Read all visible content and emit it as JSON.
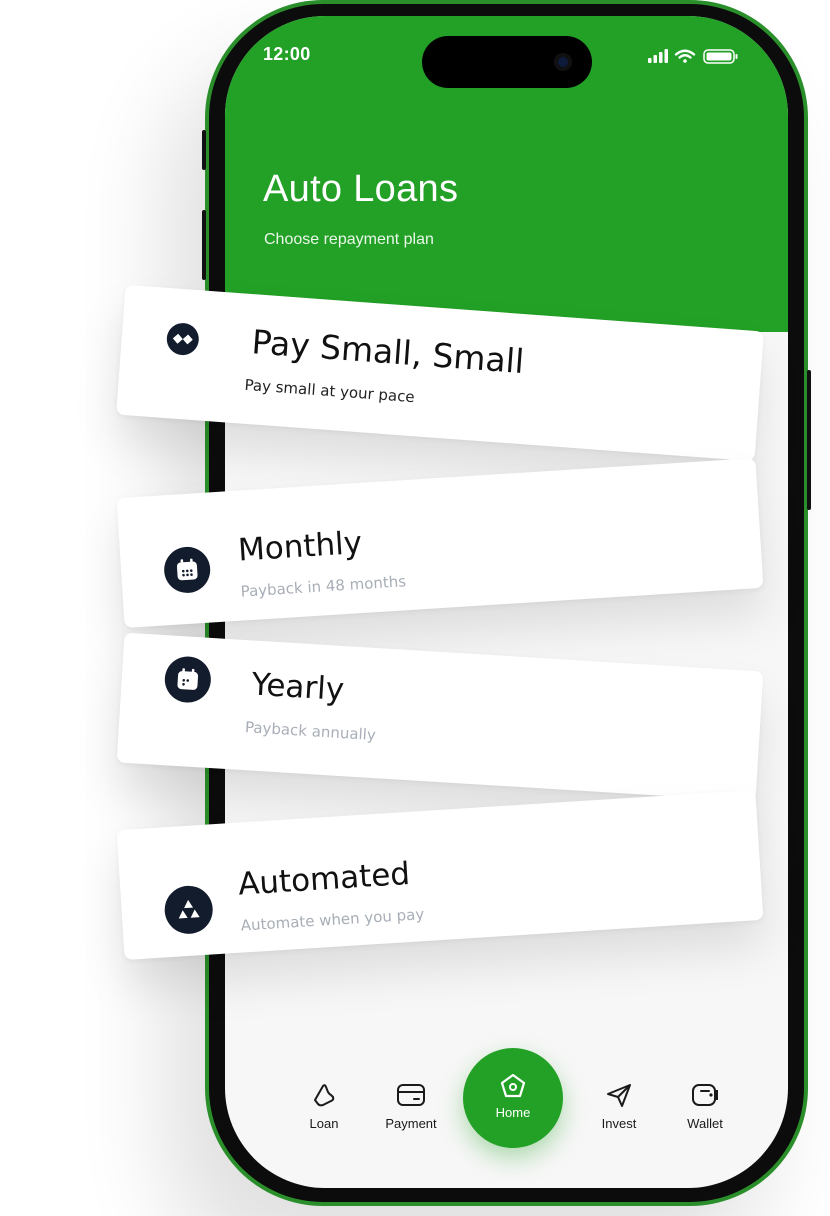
{
  "status_bar": {
    "time": "12:00"
  },
  "header": {
    "title": "Auto Loans",
    "subtitle": "Choose repayment plan",
    "accent_color": "#23a126"
  },
  "plans": [
    {
      "title": "Pay Small, Small",
      "subtitle": "Pay small at your pace",
      "icon": "diamond-dots-icon"
    },
    {
      "title": "Monthly",
      "subtitle": "Payback in 48 months",
      "icon": "calendar-icon"
    },
    {
      "title": "Yearly",
      "subtitle": "Payback annually",
      "icon": "calendar-year-icon"
    },
    {
      "title": "Automated",
      "subtitle": "Automate when you pay",
      "icon": "triangles-icon"
    }
  ],
  "bottom_nav": {
    "items": [
      {
        "label": "Loan",
        "icon": "loan-icon"
      },
      {
        "label": "Payment",
        "icon": "card-icon"
      },
      {
        "label": "Home",
        "icon": "home-icon",
        "active": true
      },
      {
        "label": "Invest",
        "icon": "send-icon"
      },
      {
        "label": "Wallet",
        "icon": "wallet-icon"
      }
    ]
  }
}
